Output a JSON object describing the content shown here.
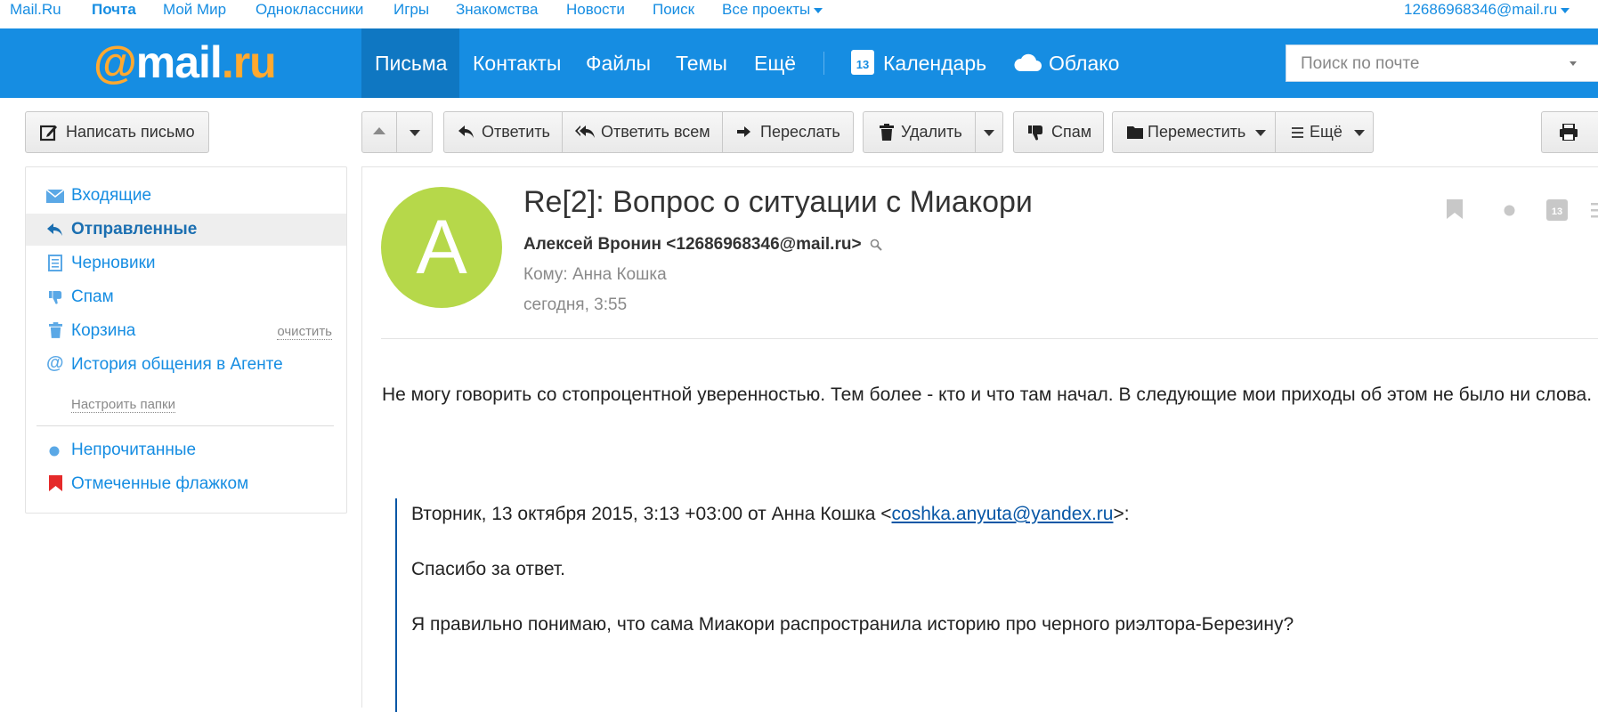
{
  "portal": {
    "links": [
      "Mail.Ru",
      "Почта",
      "Мой Мир",
      "Одноклассники",
      "Игры",
      "Знакомства",
      "Новости",
      "Поиск",
      "Все проекты"
    ],
    "account": "12686968346@mail.ru"
  },
  "header": {
    "logo": {
      "at": "@",
      "mail": "mail",
      "ru": ".ru"
    },
    "nav": [
      "Письма",
      "Контакты",
      "Файлы",
      "Темы",
      "Ещё"
    ],
    "calendar": {
      "label": "Календарь",
      "day": "13"
    },
    "cloud": "Облако",
    "search_placeholder": "Поиск по почте"
  },
  "toolbar": {
    "compose": "Написать письмо",
    "reply": "Ответить",
    "reply_all": "Ответить всем",
    "forward": "Переслать",
    "delete": "Удалить",
    "spam": "Спам",
    "move": "Переместить",
    "more": "Ещё"
  },
  "sidebar": {
    "folders": [
      {
        "label": "Входящие",
        "icon": "envelope-icon"
      },
      {
        "label": "Отправленные",
        "icon": "reply-icon",
        "selected": true
      },
      {
        "label": "Черновики",
        "icon": "draft-icon"
      },
      {
        "label": "Спам",
        "icon": "thumbs-down-icon"
      },
      {
        "label": "Корзина",
        "icon": "trash-icon",
        "action": "очистить"
      },
      {
        "label": "История общения в Агенте",
        "icon": "at-icon"
      }
    ],
    "setup": "Настроить папки",
    "filters": [
      {
        "label": "Непрочитанные",
        "icon": "dot-icon"
      },
      {
        "label": "Отмеченные флажком",
        "icon": "flag-icon"
      }
    ]
  },
  "message": {
    "avatar_letter": "А",
    "subject": "Re[2]: Вопрос о ситуации с Миакори",
    "from": "Алексей Вронин <12686968346@mail.ru>",
    "to": "Кому: Анна Кошка",
    "date": "сегодня, 3:55",
    "body": "Не могу говорить со стопроцентной уверенностью. Тем более - кто и что там начал. В следующие мои приходы об этом не было ни слова.",
    "quote": {
      "header_prefix": "Вторник, 13 октября 2015, 3:13 +03:00 от Анна Кошка <",
      "email": "coshka.anyuta@yandex.ru",
      "header_suffix": ">:",
      "line1": "Спасибо за ответ.",
      "line2": "Я правильно понимаю, что сама Миакори распространила историю про черного риэлтора-Березину?"
    },
    "calendar_day": "13"
  },
  "colors": {
    "brand": "#168de2",
    "nav_active": "#0f77c2",
    "logo_orange": "#ffa930",
    "avatar": "#b6d84a",
    "flag": "#e52a2a"
  }
}
